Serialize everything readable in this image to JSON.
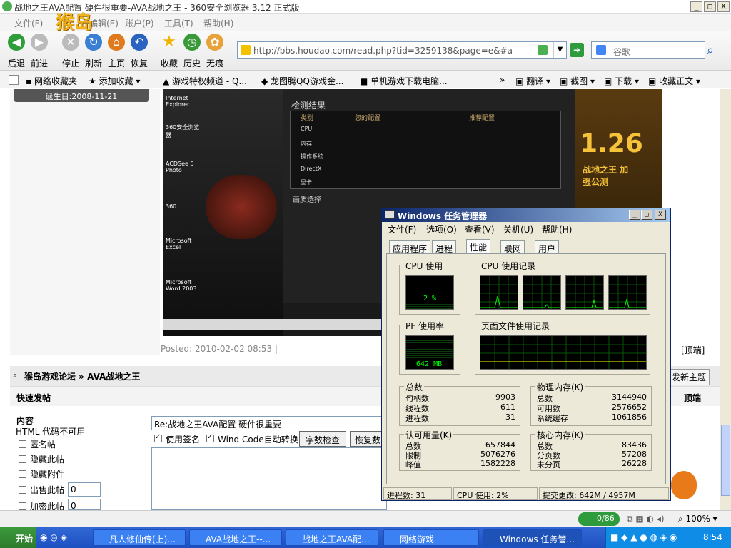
{
  "window": {
    "title": "战地之王AVA配置 硬件很重要-AVA战地之王 - 360安全浏览器 3.12 正式版",
    "min": "_",
    "max": "□",
    "close": "X"
  },
  "menu": [
    "文件(F)",
    "编辑(E)",
    "账户(P)",
    "工具(T)",
    "帮助(H)"
  ],
  "logo": "猴岛 bbs.houdao.com",
  "toolbar": {
    "back": "后退",
    "forward": "前进",
    "stop": "停止",
    "refresh": "刷新",
    "home": "主页",
    "restore": "恢复",
    "favorites": "收藏",
    "history": "历史",
    "incognito": "无痕"
  },
  "address": {
    "url": "http://bbs.houdao.com/read.php?tid=3259138&page=e&#a"
  },
  "search": {
    "placeholder": "谷歌"
  },
  "favbar": {
    "items": [
      "网络收藏夹",
      "添加收藏",
      "游戏特权频道 - Q...",
      "龙图腾QQ游戏金...",
      "单机游戏下载电脑...",
      "翻译",
      "截图",
      "下载",
      "收藏正文"
    ],
    "more": "»"
  },
  "forum": {
    "birthday": "诞生日:2008-11-21",
    "posted": "Posted: 2010-02-02 08:53 |",
    "top_link": "[顶端]",
    "breadcrumb": "猴岛游戏论坛 » AVA战地之王",
    "new_topic": "发新主题",
    "quick_post": "快速发帖",
    "quick_top": "顶端",
    "content_label": "内容",
    "html_note": "HTML 代码不可用",
    "title_value": "Re:战地之王AVA配置 硬件很重要",
    "options": [
      "匿名帖",
      "隐藏此帖",
      "隐藏附件",
      "出售此帖",
      "加密此帖"
    ],
    "sell_value": "0",
    "encrypt_value": "0",
    "use_sig": "使用签名",
    "windcode": "Wind Code自动转换",
    "check_btn": "字数检查",
    "restore_btn": "恢复数"
  },
  "game_image": {
    "panel_title": "检测结果",
    "cols": [
      "类别",
      "您的配置",
      "推荐配置"
    ],
    "rows": [
      "CPU",
      "内存",
      "操作系统",
      "DirectX",
      "显卡"
    ],
    "mode_label": "画质选择",
    "version": "1.26",
    "subtitle": "战地之王 加强公测",
    "desktop_icons": [
      "Internet Explorer",
      "360安全浏览器",
      "ACDSee 5 Photo",
      "360",
      "Microsoft Excel",
      "Microsoft Word 2003"
    ]
  },
  "taskmgr": {
    "title": "Windows 任务管理器",
    "menu": [
      "文件(F)",
      "选项(O)",
      "查看(V)",
      "关机(U)",
      "帮助(H)"
    ],
    "tabs": [
      "应用程序",
      "进程",
      "性能",
      "联网",
      "用户"
    ],
    "cpu_usage_title": "CPU 使用",
    "cpu_usage": "2 %",
    "cpu_history_title": "CPU 使用记录",
    "pf_title": "PF 使用率",
    "pf_value": "642 MB",
    "pf_history_title": "页面文件使用记录",
    "totals": {
      "title": "总数",
      "rows": [
        [
          "句柄数",
          "9903"
        ],
        [
          "线程数",
          "611"
        ],
        [
          "进程数",
          "31"
        ]
      ]
    },
    "physical": {
      "title": "物理内存(K)",
      "rows": [
        [
          "总数",
          "3144940"
        ],
        [
          "可用数",
          "2576652"
        ],
        [
          "系统缓存",
          "1061856"
        ]
      ]
    },
    "commit": {
      "title": "认可用量(K)",
      "rows": [
        [
          "总数",
          "657844"
        ],
        [
          "限制",
          "5076276"
        ],
        [
          "峰值",
          "1582228"
        ]
      ]
    },
    "kernel": {
      "title": "核心内存(K)",
      "rows": [
        [
          "总数",
          "83436"
        ],
        [
          "分页数",
          "57208"
        ],
        [
          "未分页",
          "26228"
        ]
      ]
    },
    "status": {
      "processes": "进程数: 31",
      "cpu": "CPU 使用: 2%",
      "commit": "提交更改: 642M / 4957M"
    }
  },
  "statusbar": {
    "counter": "0/86",
    "zoom": "100%"
  },
  "taskbar": {
    "start": "开始",
    "tasks": [
      "凡人修仙传(上)...",
      "AVA战地之王--...",
      "战地之王AVA配...",
      "网络游戏",
      "Windows 任务管..."
    ],
    "clock": "8:54"
  }
}
